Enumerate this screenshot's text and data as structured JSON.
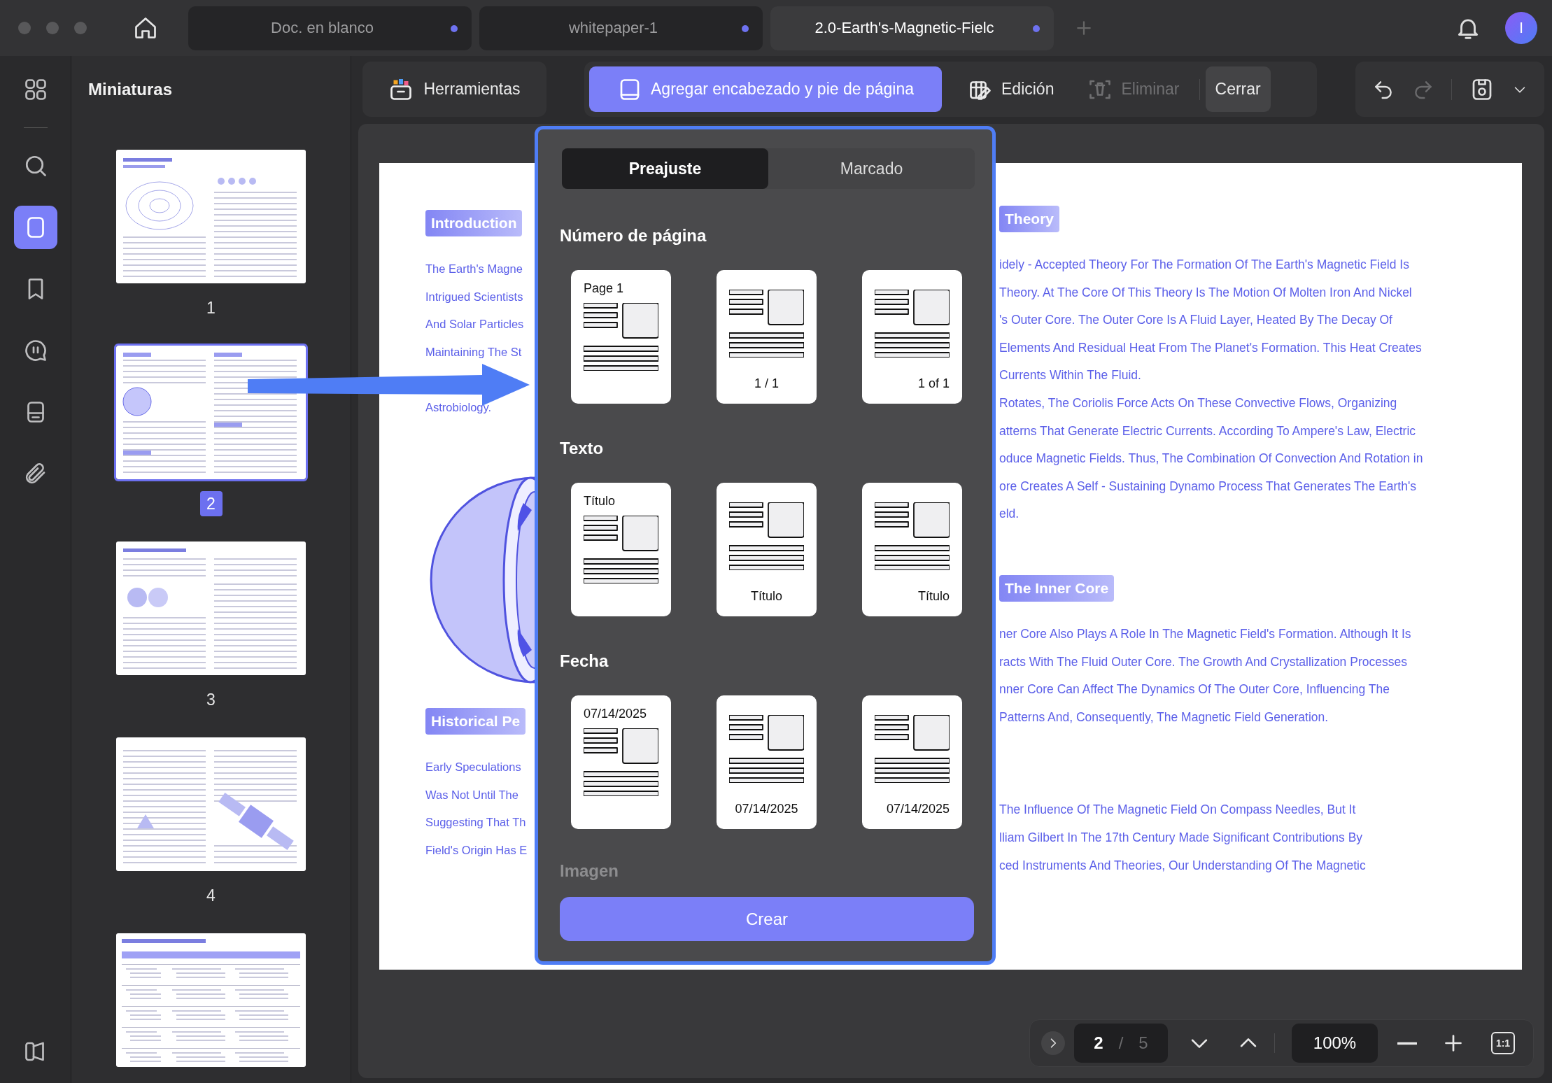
{
  "window": {
    "tabs": [
      {
        "label": "Doc. en blanco",
        "selected": false,
        "unsaved": true
      },
      {
        "label": "whitepaper-1",
        "selected": false,
        "unsaved": true
      },
      {
        "label": "2.0-Earth's-Magnetic-Fielc",
        "selected": true,
        "unsaved": true
      }
    ],
    "avatar": "I"
  },
  "rail": [
    {
      "kind": "grid",
      "selected": false
    },
    {
      "kind": "search",
      "selected": false
    },
    {
      "kind": "page",
      "selected": true
    },
    {
      "kind": "bookmark",
      "selected": false
    },
    {
      "kind": "comment",
      "selected": false
    },
    {
      "kind": "form",
      "selected": false
    },
    {
      "kind": "attachment",
      "selected": false
    }
  ],
  "sidebar": {
    "title": "Miniaturas",
    "thumbnails": [
      {
        "number": "1",
        "selected": false
      },
      {
        "number": "2",
        "selected": true
      },
      {
        "number": "3",
        "selected": false
      },
      {
        "number": "4",
        "selected": false
      },
      {
        "selected": false
      }
    ]
  },
  "toolbar": {
    "tools": "Herramientas",
    "actions": [
      {
        "label": "Agregar encabezado y pie de página",
        "kind": "header-footer",
        "selected": true,
        "disabled": false
      },
      {
        "label": "Edición",
        "kind": "edit",
        "selected": false,
        "disabled": false
      },
      {
        "label": "Eliminar",
        "kind": "delete",
        "selected": false,
        "disabled": true
      }
    ],
    "close": "Cerrar",
    "undo": {
      "disabled": false
    },
    "redo": {
      "disabled": true
    }
  },
  "document": {
    "left": [
      {
        "heading": "Introduction",
        "figure": true,
        "paragraphs": [
          [
            "The Earth's Magne",
            "Intrigued Scientists",
            "And Solar Particles",
            "Maintaining The St"
          ],
          [
            "Astrobiology."
          ]
        ]
      },
      {
        "heading": "Historical Pe",
        "paragraphs": [
          [
            "Early Speculations",
            "Was Not Until The",
            "Suggesting That Th",
            "Field's Origin Has E"
          ]
        ]
      }
    ],
    "right": [
      {
        "heading": "Theory",
        "paragraphs": [
          [
            "idely - Accepted Theory For The Formation Of The Earth's Magnetic Field Is",
            "Theory. At The Core Of This Theory Is The Motion Of Molten Iron And Nickel",
            "'s Outer Core. The Outer Core Is A Fluid Layer, Heated By The Decay Of",
            "Elements And Residual Heat From The Planet's Formation. This Heat Creates",
            "Currents Within The Fluid.",
            "Rotates, The Coriolis Force Acts On These Convective Flows, Organizing",
            "atterns That Generate Electric Currents. According To Ampere's Law, Electric",
            "oduce Magnetic Fields. Thus, The Combination Of Convection And Rotation in",
            "ore Creates A Self - Sustaining Dynamo Process That Generates The Earth's",
            "eld."
          ]
        ]
      },
      {
        "heading": "The Inner Core",
        "paragraphs": [
          [
            "ner Core Also Plays A Role In The Magnetic Field's Formation. Although It Is",
            "racts With The Fluid Outer Core. The Growth And Crystallization Processes",
            "nner Core Can Affect The Dynamics Of The Outer Core, Influencing The",
            "Patterns And, Consequently, The Magnetic Field Generation."
          ]
        ]
      },
      {
        "paragraphs": [
          [
            "The Influence Of The Magnetic Field On Compass Needles, But It",
            "lliam Gilbert In The 17th Century Made Significant Contributions By",
            "ced Instruments And Theories, Our Understanding Of The Magnetic"
          ]
        ]
      }
    ]
  },
  "popup": {
    "tabs": [
      {
        "label": "Preajuste",
        "selected": true
      },
      {
        "label": "Marcado",
        "selected": false
      }
    ],
    "sections": [
      {
        "title": "Número de página",
        "options": [
          {
            "text": "Page 1",
            "kind": "top-left"
          },
          {
            "text": "1 / 1",
            "kind": "bottom-center"
          },
          {
            "text": "1 of 1",
            "kind": "bottom-right"
          }
        ]
      },
      {
        "title": "Texto",
        "options": [
          {
            "text": "Título",
            "kind": "top-left"
          },
          {
            "text": "Título",
            "kind": "bottom-center"
          },
          {
            "text": "Título",
            "kind": "bottom-right"
          }
        ]
      },
      {
        "title": "Fecha",
        "options": [
          {
            "text": "07/14/2025",
            "kind": "top-left"
          },
          {
            "text": "07/14/2025",
            "kind": "bottom-center"
          },
          {
            "text": "07/14/2025",
            "kind": "bottom-right"
          }
        ]
      }
    ],
    "next_section": "Imagen",
    "button": "Crear"
  },
  "pager": {
    "page": "2",
    "separator": "/",
    "total": "5",
    "zoom": "100%",
    "actual_size": "1:1"
  }
}
